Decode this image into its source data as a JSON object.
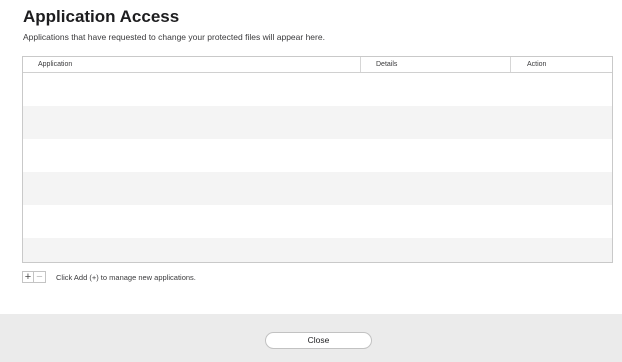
{
  "header": {
    "title": "Application Access",
    "subtitle": "Applications that have requested to change your protected files will appear here."
  },
  "table": {
    "columns": [
      "Application",
      "Details",
      "Action"
    ],
    "rows": []
  },
  "list_controls": {
    "add_label": "+",
    "remove_label": "−",
    "hint": "Click Add (+) to manage new applications."
  },
  "footer": {
    "close_label": "Close"
  },
  "colors": {
    "footer_background": "#ebebeb",
    "row_stripe": "#f4f4f4",
    "border": "#c9c9c9"
  }
}
